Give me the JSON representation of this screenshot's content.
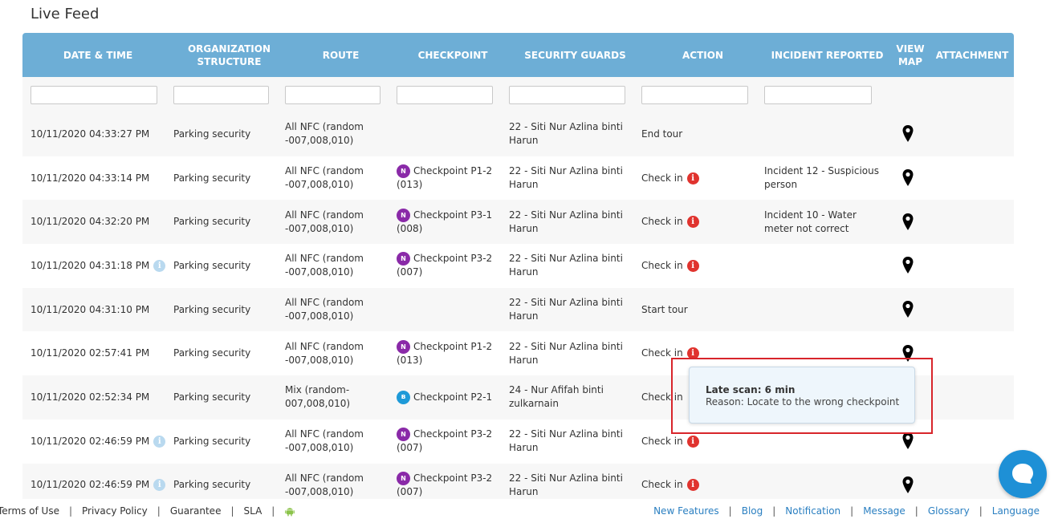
{
  "page": {
    "title": "Live Feed"
  },
  "table": {
    "headers": [
      "DATE & TIME",
      "ORGANIZATION STRUCTURE",
      "ROUTE",
      "CHECKPOINT",
      "SECURITY GUARDS",
      "ACTION",
      "INCIDENT REPORTED",
      "VIEW MAP",
      "ATTACHMENT"
    ],
    "rows": [
      {
        "datetime": "10/11/2020 04:33:27 PM",
        "info": false,
        "org": "Parking security",
        "route": "All NFC (random -007,008,010)",
        "checkpoint": "",
        "cp_type": "",
        "guard": "22 - Siti Nur Azlina binti Harun",
        "action": "End tour",
        "alert": false,
        "incident": ""
      },
      {
        "datetime": "10/11/2020 04:33:14 PM",
        "info": false,
        "org": "Parking security",
        "route": "All NFC (random -007,008,010)",
        "checkpoint": "Checkpoint P1-2 (013)",
        "cp_type": "nfc",
        "guard": "22 - Siti Nur Azlina binti Harun",
        "action": "Check in",
        "alert": true,
        "incident": "Incident 12 - Suspicious person"
      },
      {
        "datetime": "10/11/2020 04:32:20 PM",
        "info": false,
        "org": "Parking security",
        "route": "All NFC (random -007,008,010)",
        "checkpoint": "Checkpoint P3-1 (008)",
        "cp_type": "nfc",
        "guard": "22 - Siti Nur Azlina binti Harun",
        "action": "Check in",
        "alert": true,
        "incident": "Incident 10 - Water meter not correct"
      },
      {
        "datetime": "10/11/2020 04:31:18 PM",
        "info": true,
        "org": "Parking security",
        "route": "All NFC (random -007,008,010)",
        "checkpoint": "Checkpoint P3-2 (007)",
        "cp_type": "nfc",
        "guard": "22 - Siti Nur Azlina binti Harun",
        "action": "Check in",
        "alert": true,
        "incident": ""
      },
      {
        "datetime": "10/11/2020 04:31:10 PM",
        "info": false,
        "org": "Parking security",
        "route": "All NFC (random -007,008,010)",
        "checkpoint": "",
        "cp_type": "",
        "guard": "22 - Siti Nur Azlina binti Harun",
        "action": "Start tour",
        "alert": false,
        "incident": ""
      },
      {
        "datetime": "10/11/2020 02:57:41 PM",
        "info": false,
        "org": "Parking security",
        "route": "All NFC (random -007,008,010)",
        "checkpoint": "Checkpoint P1-2 (013)",
        "cp_type": "nfc",
        "guard": "22 - Siti Nur Azlina binti Harun",
        "action": "Check in",
        "alert": true,
        "incident": ""
      },
      {
        "datetime": "10/11/2020 02:52:34 PM",
        "info": false,
        "org": "Parking security",
        "route": "Mix (random-007,008,010)",
        "checkpoint": "Checkpoint P2-1",
        "cp_type": "ble",
        "guard": "24 - Nur Afifah binti zulkarnain",
        "action": "Check in",
        "alert": false,
        "incident": ""
      },
      {
        "datetime": "10/11/2020 02:46:59 PM",
        "info": true,
        "org": "Parking security",
        "route": "All NFC (random -007,008,010)",
        "checkpoint": "Checkpoint P3-2 (007)",
        "cp_type": "nfc",
        "guard": "22 - Siti Nur Azlina binti Harun",
        "action": "Check in",
        "alert": true,
        "incident": ""
      },
      {
        "datetime": "10/11/2020 02:46:59 PM",
        "info": true,
        "org": "Parking security",
        "route": "All NFC (random -007,008,010)",
        "checkpoint": "Checkpoint P3-2 (007)",
        "cp_type": "nfc",
        "guard": "22 - Siti Nur Azlina binti Harun",
        "action": "Check in",
        "alert": true,
        "incident": ""
      }
    ]
  },
  "tooltip": {
    "title": "Late scan: 6 min",
    "reason": "Reason: Locate to the wrong checkpoint"
  },
  "footer": {
    "left": [
      "Terms of Use",
      "Privacy Policy",
      "Guarantee",
      "SLA"
    ],
    "right": [
      "New Features",
      "Blog",
      "Notification",
      "Message",
      "Glossary",
      "Language"
    ]
  },
  "colors": {
    "header": "#6daed6",
    "alert": "#e0332e",
    "link": "#2a7fc1",
    "nfc": "#8a2aa8",
    "ble": "#1e9ad8",
    "highlight": "#d8252b"
  }
}
